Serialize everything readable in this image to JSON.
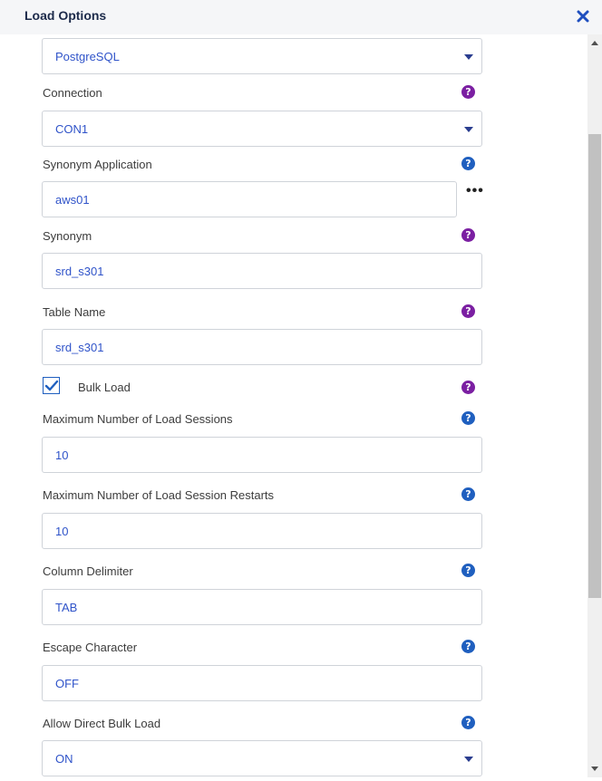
{
  "dialog": {
    "title": "Load Options",
    "close_icon": "close-icon"
  },
  "fields": {
    "adapter": {
      "value": "PostgreSQL"
    },
    "connection": {
      "label": "Connection",
      "value": "CON1"
    },
    "synonym_application": {
      "label": "Synonym Application",
      "value": "aws01",
      "browse_label": "•••"
    },
    "synonym": {
      "label": "Synonym",
      "value": "srd_s301"
    },
    "table_name": {
      "label": "Table Name",
      "value": "srd_s301"
    },
    "bulk_load": {
      "label": "Bulk Load",
      "checked": true
    },
    "max_load_sessions": {
      "label": "Maximum Number of Load Sessions",
      "value": "10"
    },
    "max_load_session_restarts": {
      "label": "Maximum Number of Load Session Restarts",
      "value": "10"
    },
    "column_delimiter": {
      "label": "Column Delimiter",
      "value": "TAB"
    },
    "escape_character": {
      "label": "Escape Character",
      "value": "OFF"
    },
    "allow_direct_bulk_load": {
      "label": "Allow Direct Bulk Load",
      "value": "ON"
    }
  },
  "help": {
    "glyph": "?"
  },
  "colors": {
    "accent": "#2f53c9",
    "help_purple": "#7b1fa2",
    "help_blue": "#1f5fbf",
    "header_bg": "#f5f6f8",
    "title": "#1c2a4a"
  }
}
